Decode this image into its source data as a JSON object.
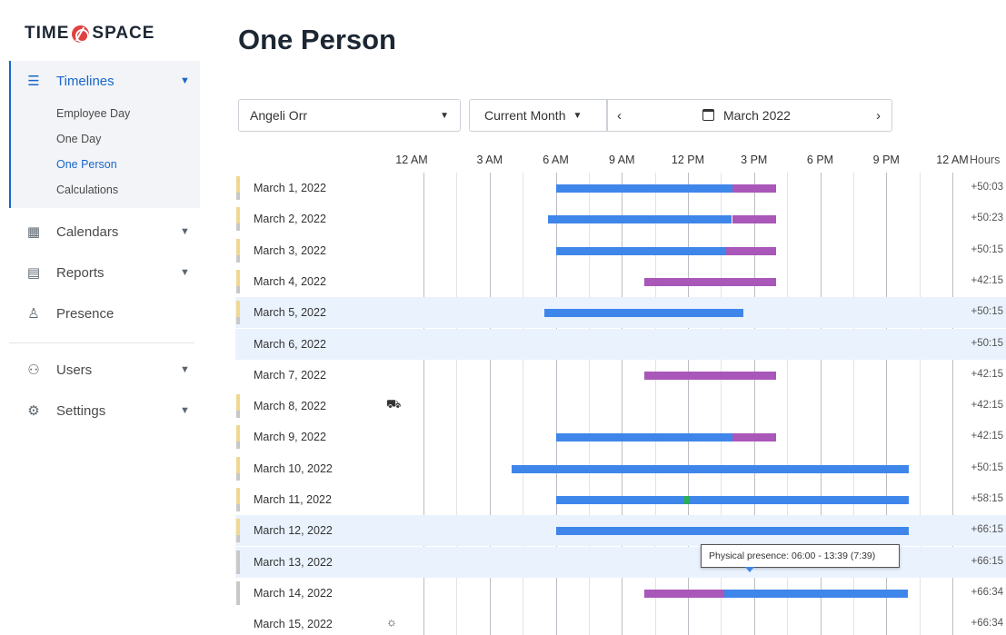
{
  "app": {
    "logo_left": "TIME",
    "logo_right": "SPACE"
  },
  "sidebar": {
    "timelines": {
      "label": "Timelines",
      "icon": "menu-icon"
    },
    "sub_items": [
      "Employee Day",
      "One Day",
      "One Person",
      "Calculations"
    ],
    "items": [
      {
        "label": "Calendars",
        "icon": "calendar-icon"
      },
      {
        "label": "Reports",
        "icon": "report-icon"
      },
      {
        "label": "Presence",
        "icon": "presence-icon"
      },
      {
        "label": "Users",
        "icon": "users-icon"
      },
      {
        "label": "Settings",
        "icon": "gear-icon"
      }
    ]
  },
  "page": {
    "title": "One Person"
  },
  "controls": {
    "person": "Angeli Orr",
    "range": "Current Month",
    "period": "March 2022",
    "prev": "‹",
    "next": "›"
  },
  "axis": {
    "labels": [
      "12 AM",
      "3 AM",
      "6 AM",
      "9 AM",
      "12 PM",
      "3 PM",
      "6 PM",
      "9 PM",
      "12 AM"
    ],
    "hours_header": "Hours"
  },
  "rows": [
    {
      "date": "March 1, 2022",
      "hours": "+50:03",
      "marker": "gold",
      "bars": [
        {
          "color": "blue",
          "from": "06:00",
          "to": "14:00"
        },
        {
          "color": "purple",
          "from": "14:00",
          "to": "16:00"
        }
      ]
    },
    {
      "date": "March 2, 2022",
      "hours": "+50:23",
      "marker": "gold",
      "bars": [
        {
          "color": "blue",
          "from": "05:40",
          "to": "14:00"
        },
        {
          "color": "purple",
          "from": "14:00",
          "to": "16:00"
        }
      ]
    },
    {
      "date": "March 3, 2022",
      "hours": "+50:15",
      "marker": "gold",
      "bars": [
        {
          "color": "blue",
          "from": "06:00",
          "to": "13:45"
        },
        {
          "color": "purple",
          "from": "13:45",
          "to": "16:00"
        }
      ]
    },
    {
      "date": "March 4, 2022",
      "hours": "+42:15",
      "marker": "gold",
      "bars": [
        {
          "color": "purple",
          "from": "10:00",
          "to": "16:00"
        }
      ]
    },
    {
      "date": "March 5, 2022",
      "hours": "+50:15",
      "marker": "gold",
      "highlight": true,
      "bars": [
        {
          "color": "blue",
          "from": "05:30",
          "to": "14:30"
        }
      ]
    },
    {
      "date": "March 6, 2022",
      "hours": "+50:15",
      "marker": "none",
      "highlight": true,
      "bars": []
    },
    {
      "date": "March 7, 2022",
      "hours": "+42:15",
      "marker": "none",
      "bars": [
        {
          "color": "purple",
          "from": "10:00",
          "to": "16:00"
        }
      ]
    },
    {
      "date": "March 8, 2022",
      "hours": "+42:15",
      "marker": "gold",
      "icon": "car-icon",
      "bars": []
    },
    {
      "date": "March 9, 2022",
      "hours": "+42:15",
      "marker": "gold",
      "bars": [
        {
          "color": "blue",
          "from": "06:00",
          "to": "14:00"
        },
        {
          "color": "purple",
          "from": "14:00",
          "to": "16:00"
        }
      ]
    },
    {
      "date": "March 10, 2022",
      "hours": "+50:15",
      "marker": "gold",
      "bars": [
        {
          "color": "blue",
          "from": "04:00",
          "to": "22:00"
        }
      ]
    },
    {
      "date": "March 11, 2022",
      "hours": "+58:15",
      "marker": "gold",
      "bars": [
        {
          "color": "blue",
          "from": "06:00",
          "to": "22:00"
        },
        {
          "color": "green",
          "from": "11:50",
          "to": "12:05"
        }
      ]
    },
    {
      "date": "March 12, 2022",
      "hours": "+66:15",
      "marker": "gold",
      "highlight": true,
      "bars": [
        {
          "color": "blue",
          "from": "06:00",
          "to": "22:00"
        }
      ]
    },
    {
      "date": "March 13, 2022",
      "hours": "+66:15",
      "marker": "gray",
      "highlight": true,
      "bars": []
    },
    {
      "date": "March 14, 2022",
      "hours": "+66:34",
      "marker": "gray",
      "bars": [
        {
          "color": "purple",
          "from": "10:00",
          "to": "13:40"
        },
        {
          "color": "blue",
          "from": "13:40",
          "to": "22:00"
        }
      ]
    },
    {
      "date": "March 15, 2022",
      "hours": "+66:34",
      "marker": "none",
      "icon": "sun-icon",
      "bars": []
    }
  ],
  "tooltip": {
    "text": "Physical presence: 06:00 - 13:39 (7:39)"
  },
  "colors": {
    "accent": "#1a66c9",
    "work": "#3f86ea",
    "absence": "#a957b8",
    "presence": "#2ab24b",
    "highlight": "#eaf3fd"
  }
}
